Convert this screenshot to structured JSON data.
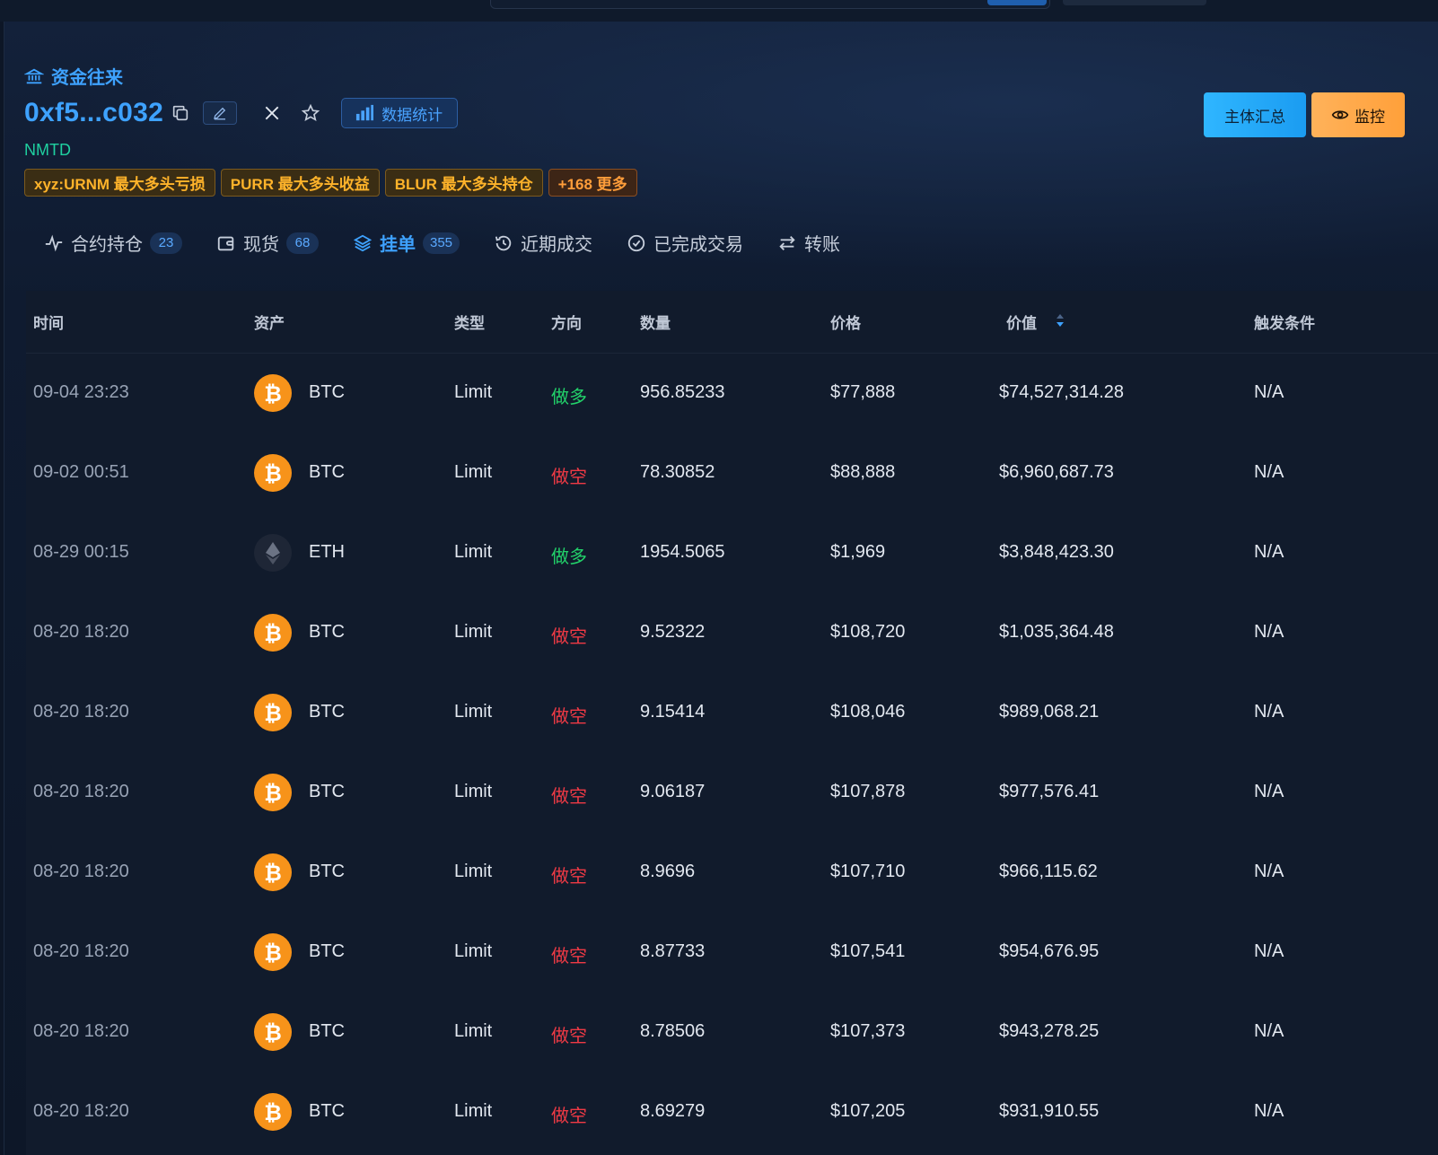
{
  "header": {
    "section_title": "资金往来",
    "address": "0xf5...c032",
    "label": "NMTD",
    "stats_button": "数据统计",
    "summary_button": "主体汇总",
    "monitor_button": "监控",
    "tags": [
      {
        "text": "xyz:URNM 最大多头亏损"
      },
      {
        "text": "PURR 最大多头收益"
      },
      {
        "text": "BLUR 最大多头持仓"
      },
      {
        "text": "+168 更多"
      }
    ]
  },
  "tabs": [
    {
      "label": "合约持仓",
      "count": "23",
      "icon": "pulse-icon"
    },
    {
      "label": "现货",
      "count": "68",
      "icon": "wallet-icon"
    },
    {
      "label": "挂单",
      "count": "355",
      "icon": "layers-icon",
      "active": true
    },
    {
      "label": "近期成交",
      "icon": "history-icon"
    },
    {
      "label": "已完成交易",
      "icon": "check-circle-icon"
    },
    {
      "label": "转账",
      "icon": "transfer-icon"
    }
  ],
  "table": {
    "columns": [
      "时间",
      "资产",
      "类型",
      "方向",
      "数量",
      "价格",
      "价值",
      "触发条件"
    ],
    "rows": [
      {
        "time": "09-04 23:23",
        "asset": "BTC",
        "type": "Limit",
        "side": "做多",
        "qty": "956.85233",
        "price": "$77,888",
        "value": "$74,527,314.28",
        "trigger": "N/A"
      },
      {
        "time": "09-02 00:51",
        "asset": "BTC",
        "type": "Limit",
        "side": "做空",
        "qty": "78.30852",
        "price": "$88,888",
        "value": "$6,960,687.73",
        "trigger": "N/A"
      },
      {
        "time": "08-29 00:15",
        "asset": "ETH",
        "type": "Limit",
        "side": "做多",
        "qty": "1954.5065",
        "price": "$1,969",
        "value": "$3,848,423.30",
        "trigger": "N/A"
      },
      {
        "time": "08-20 18:20",
        "asset": "BTC",
        "type": "Limit",
        "side": "做空",
        "qty": "9.52322",
        "price": "$108,720",
        "value": "$1,035,364.48",
        "trigger": "N/A"
      },
      {
        "time": "08-20 18:20",
        "asset": "BTC",
        "type": "Limit",
        "side": "做空",
        "qty": "9.15414",
        "price": "$108,046",
        "value": "$989,068.21",
        "trigger": "N/A"
      },
      {
        "time": "08-20 18:20",
        "asset": "BTC",
        "type": "Limit",
        "side": "做空",
        "qty": "9.06187",
        "price": "$107,878",
        "value": "$977,576.41",
        "trigger": "N/A"
      },
      {
        "time": "08-20 18:20",
        "asset": "BTC",
        "type": "Limit",
        "side": "做空",
        "qty": "8.9696",
        "price": "$107,710",
        "value": "$966,115.62",
        "trigger": "N/A"
      },
      {
        "time": "08-20 18:20",
        "asset": "BTC",
        "type": "Limit",
        "side": "做空",
        "qty": "8.87733",
        "price": "$107,541",
        "value": "$954,676.95",
        "trigger": "N/A"
      },
      {
        "time": "08-20 18:20",
        "asset": "BTC",
        "type": "Limit",
        "side": "做空",
        "qty": "8.78506",
        "price": "$107,373",
        "value": "$943,278.25",
        "trigger": "N/A"
      },
      {
        "time": "08-20 18:20",
        "asset": "BTC",
        "type": "Limit",
        "side": "做空",
        "qty": "8.69279",
        "price": "$107,205",
        "value": "$931,910.55",
        "trigger": "N/A"
      }
    ]
  },
  "colors": {
    "accent": "#3ea2ff",
    "long": "#22d36a",
    "short": "#f03a45",
    "btc": "#f7931a"
  }
}
